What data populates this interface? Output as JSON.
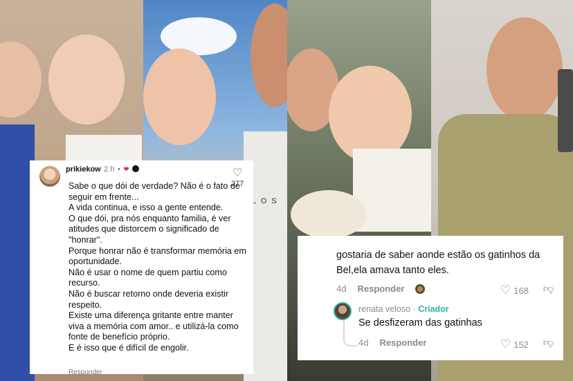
{
  "card_left": {
    "username": "prikiekow",
    "time": "2 h",
    "separator": "•",
    "like_count": "277",
    "body": [
      "Sabe o que dói de verdade? Não é o fato de seguir em frente...",
      "A vida continua, e isso a gente entende.",
      "O que dói, pra nós enquanto familia, é ver atitudes que distorcem o significado de \"honrar\".",
      "Porque honrar não é transformar memória em oportunidade.",
      "Não é usar o nome de quem partiu como recurso.",
      "Não é buscar retorno onde deveria existir respeito.",
      "Existe uma diferença gritante entre manter viva a memória com amor.. e utilizá-la como fonte de benefício próprio.",
      "E é isso que é difícil de engolir."
    ],
    "reply_label": "Responder"
  },
  "card_right": {
    "question": "gostaria de saber aonde estão os gatinhos da Bel,ela amava tanto eles.",
    "q_time": "4d",
    "q_reply": "Responder",
    "q_likes": "168",
    "reply_name": "renata veloso",
    "reply_sep": "·",
    "reply_role": "Criador",
    "reply_text": "Se desfizeram das gatinhas",
    "r_time": "4d",
    "r_reply": "Responder",
    "r_likes": "152"
  },
  "photo_text": {
    "shirt": "L O S"
  },
  "colors": {
    "creator": "#2bb3a8",
    "heart": "#e0245e"
  }
}
